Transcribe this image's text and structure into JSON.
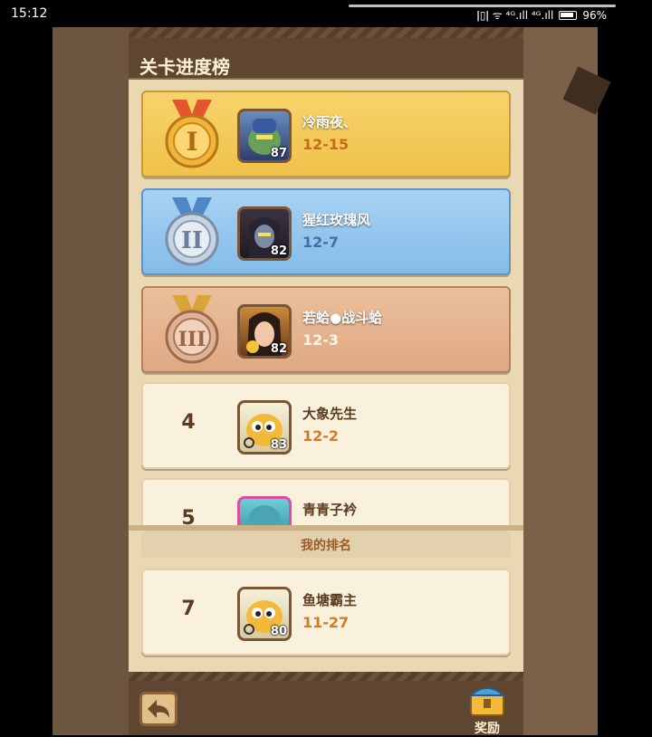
{
  "status": {
    "time": "15:12",
    "indicators": "ǀ▯ǀ ᯤ ⁴ᴳ.ıll ⁴ᴳ.ıll",
    "battery": "96%"
  },
  "panel": {
    "title": "关卡进度榜"
  },
  "ranks": [
    {
      "rank": "1",
      "tier": "gold",
      "name": "冷雨夜、",
      "stage": "12-15",
      "level": "87",
      "stage_color": "#c96a1a"
    },
    {
      "rank": "2",
      "tier": "silver",
      "name": "猩红玫瑰风",
      "stage": "12-7",
      "level": "82",
      "stage_color": "#3f6fa5"
    },
    {
      "rank": "3",
      "tier": "bronze",
      "name": "若蛤●战斗蛤",
      "stage": "12-3",
      "level": "82",
      "stage_color": "#fff6ea"
    },
    {
      "rank": "4",
      "tier": "plain",
      "name": "大象先生",
      "stage": "12-2",
      "level": "83",
      "stage_color": "#d07a2a"
    },
    {
      "rank": "5",
      "tier": "plain",
      "name": "青青子衿",
      "stage": "",
      "level": "",
      "stage_color": "#d07a2a"
    }
  ],
  "my_rank": {
    "label": "我的排名",
    "rank": "7",
    "name": "鱼塘霸主",
    "stage": "11-27",
    "level": "80"
  },
  "bottom": {
    "reward_label": "奖励",
    "back_icon": "back-arrow-icon",
    "reward_icon": "treasure-chest-icon"
  }
}
